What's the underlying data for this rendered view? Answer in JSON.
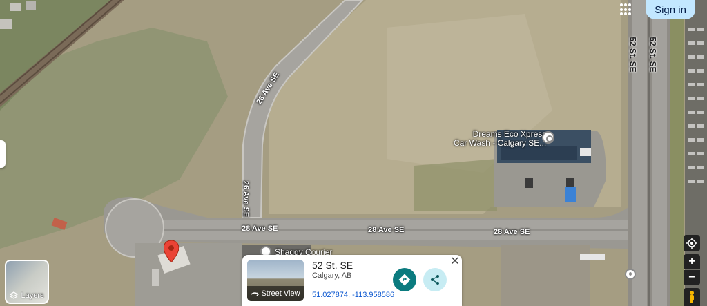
{
  "header": {
    "sign_in_label": "Sign in",
    "apps_icon": "apps-grid-icon"
  },
  "roads": {
    "ave26_upper": "26 Ave SE",
    "ave26_lower": "26 Ave SE",
    "ave28_a": "28 Ave SE",
    "ave28_b": "28 Ave SE",
    "ave28_c": "28 Ave SE",
    "st52_a": "52 St. SE",
    "st52_b": "52 St. SE"
  },
  "pois": {
    "car_wash_line1": "Dreams Eco Xpress",
    "car_wash_line2": "Car Wash - Calgary SE...",
    "courier": "Shaggy Courier"
  },
  "place_card": {
    "title": "52 St. SE",
    "subtitle": "Calgary, AB",
    "coordinates": "51.027874, -113.958586",
    "street_view_label": "Street View",
    "close_symbol": "✕"
  },
  "layers": {
    "label": "Layers"
  },
  "controls": {
    "zoom_in": "+",
    "zoom_out": "−"
  },
  "colors": {
    "pin": "#ea4335",
    "directions": "#0b7b7f",
    "signin_bg": "#c2e7ff"
  }
}
